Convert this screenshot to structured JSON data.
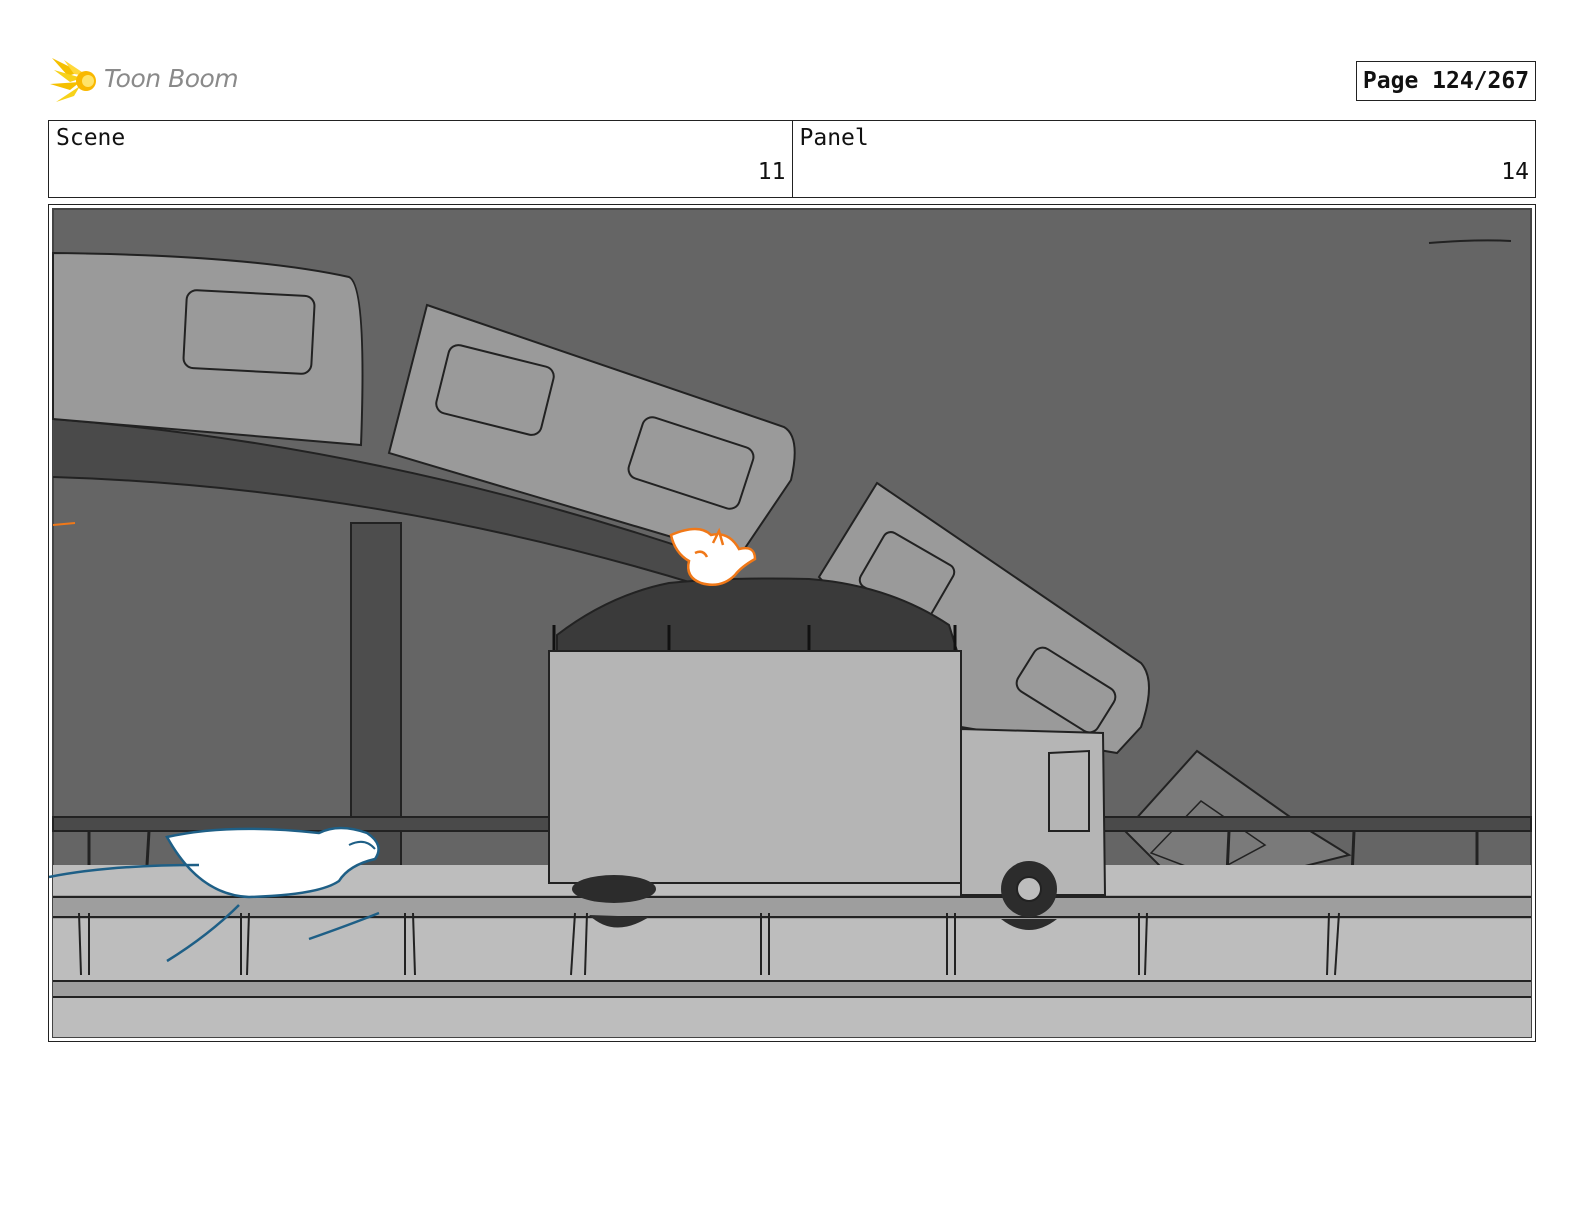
{
  "header": {
    "logo_text": "Toon Boom",
    "page_label": "Page 124/267"
  },
  "info": {
    "scene_label": "Scene",
    "scene_value": "11",
    "panel_label": "Panel",
    "panel_value": "14"
  },
  "colors": {
    "sky": "#656565",
    "bridge": "#9a9a9a",
    "truck": "#b5b5b5",
    "road": "#bdbdbd",
    "accent_orange": "#f07818",
    "creature_blue": "#1e5f86"
  }
}
